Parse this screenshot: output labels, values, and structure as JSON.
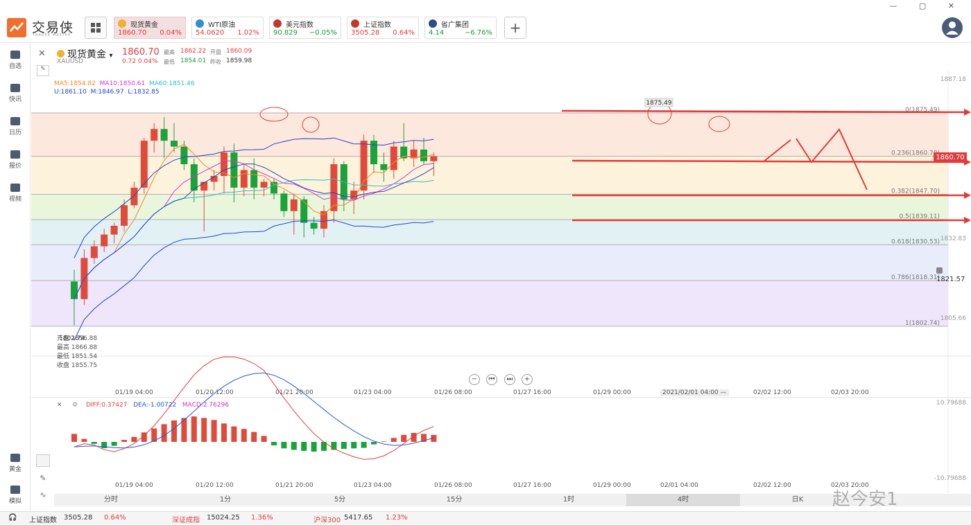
{
  "app": {
    "name": "交易侠",
    "sub": "TRADER MASTER"
  },
  "window_controls": "— ▢ ✕",
  "tickers": [
    {
      "name": "现货黄金",
      "price": "1860.70",
      "pct": "0.04%",
      "color": "#e23b3b",
      "icon_color": "#f0b030",
      "active": true
    },
    {
      "name": "WTI原油",
      "price": "54.0620",
      "pct": "1.02%",
      "color": "#e23b3b",
      "icon_color": "#2d8fd5"
    },
    {
      "name": "美元指数",
      "price": "90.829",
      "pct": "−0.05%",
      "color": "#1a9a3a",
      "icon_color": "#c0392b"
    },
    {
      "name": "上证指数",
      "price": "3505.28",
      "pct": "0.64%",
      "color": "#e23b3b",
      "icon_color": "#c0392b"
    },
    {
      "name": "省广集团",
      "price": "4.14",
      "pct": "−6.76%",
      "color": "#1a9a3a",
      "icon_color": "#2a4d8c"
    }
  ],
  "add_label": "+",
  "nav": [
    {
      "label": "自选",
      "icon": "star-icon"
    },
    {
      "label": "快讯",
      "icon": "news-icon"
    },
    {
      "label": "日历",
      "icon": "calendar-icon"
    },
    {
      "label": "报价",
      "icon": "quote-icon"
    },
    {
      "label": "视频",
      "icon": "video-icon"
    }
  ],
  "nav_bottom": [
    {
      "label": "黄金",
      "icon": "gold-icon"
    },
    {
      "label": "模拟",
      "icon": "simulate-icon"
    }
  ],
  "symbol": {
    "name": "现货黄金",
    "dropdown": "▾",
    "code": "XAUUSD",
    "price": "1860.70",
    "change": "0.72  0.04%",
    "quote_labels": [
      "最高",
      "开盘",
      "最低",
      "昨收"
    ],
    "high": "1862.22",
    "open": "1860.09",
    "low": "1854.01",
    "prev_close": "1859.98"
  },
  "indicators": {
    "ma5": "MA5:1854.82",
    "ma10": "MA10:1850.61",
    "ma60": "MA60:1851.46",
    "boll_u": "U:1861.10",
    "boll_m": "M:1846.97",
    "boll_l": "L:1832.85"
  },
  "macd_legend": {
    "diff": "DIFF:0.37427",
    "dea": "DEA:-1.00722",
    "macd": "MACD:2.76296"
  },
  "fib_levels": [
    {
      "label": "0(1875.49)",
      "price": 1875.49
    },
    {
      "label": "0.236(1860.70)",
      "price": 1860.7
    },
    {
      "label": "0.382(1847.70)",
      "price": 1847.7
    },
    {
      "label": "0.5(1839.11)",
      "price": 1839.11
    },
    {
      "label": "0.618(1830.53)",
      "price": 1830.53
    },
    {
      "label": "0.786(1818.31)",
      "price": 1818.31
    },
    {
      "label": "1(1802.74)",
      "price": 1802.74
    }
  ],
  "price_axis": {
    "top": "1887.18",
    "mid": "1832.83",
    "bottom": "1805.66"
  },
  "current_price_tag": "1860.70",
  "alert_price": "1821.57",
  "high_marker": "1875.49",
  "low_marker": "1802.74",
  "ohlc_box": [
    "开盘 1856.88",
    "最高 1866.88",
    "最低 1851.54",
    "收盘 1855.75"
  ],
  "time_labels": [
    "01/19 04:00",
    "01/20 12:00",
    "01/21 20:00",
    "01/23 04:00",
    "01/26 08:00",
    "01/27 16:00",
    "01/29 00:00",
    "2021/02/01 04:00 —",
    "02/02 12:00",
    "02/03 20:00"
  ],
  "macd_time_labels": [
    "01/19 04:00",
    "01/20 12:00",
    "01/21 20:00",
    "01/23 04:00",
    "01/26 08:00",
    "01/27 16:00",
    "01/29 00:00",
    "02/01 04:00",
    "02/02 12:00",
    "02/03 20:00"
  ],
  "macd_axis": {
    "top": "10.79688",
    "bottom": "-10.79688"
  },
  "zoom_controls": [
    "−",
    "⏮",
    "⏭",
    "+"
  ],
  "periods": [
    "分时",
    "1分",
    "5分",
    "15分",
    "1时",
    "4时",
    "日K"
  ],
  "active_period": "4时",
  "status": {
    "sh_name": "上证指数",
    "sh_val": "3505.28",
    "sh_pct": "0.64%",
    "sz_name": "深证成指",
    "sz_val": "15024.25",
    "sz_pct": "1.36%",
    "hs_name": "沪深300",
    "hs_val": "5417.65",
    "hs_pct": "1.23%"
  },
  "watermark": "赵今安1",
  "chart_data": {
    "type": "candlestick",
    "x": [
      "01/19 04:00",
      "01/20 12:00",
      "01/21 20:00",
      "01/23 04:00",
      "01/26 08:00",
      "01/27 16:00",
      "01/29 00:00",
      "02/01 04:00",
      "02/02 12:00"
    ],
    "ohlc": [
      [
        1818.0,
        1822.0,
        1803.0,
        1812.0
      ],
      [
        1812.0,
        1829.0,
        1810.0,
        1826.0
      ],
      [
        1826.0,
        1832.0,
        1824.0,
        1830.0
      ],
      [
        1830.0,
        1836.0,
        1828.0,
        1834.0
      ],
      [
        1834.0,
        1838.0,
        1831.0,
        1837.0
      ],
      [
        1837.0,
        1846.0,
        1835.0,
        1844.0
      ],
      [
        1844.0,
        1852.0,
        1843.0,
        1850.0
      ],
      [
        1850.0,
        1867.0,
        1848.0,
        1866.0
      ],
      [
        1866.0,
        1872.0,
        1862.0,
        1870.0
      ],
      [
        1870.0,
        1874.0,
        1860.0,
        1866.0
      ],
      [
        1866.0,
        1872.0,
        1862.0,
        1864.0
      ],
      [
        1864.0,
        1866.0,
        1856.0,
        1858.0
      ],
      [
        1858.0,
        1860.0,
        1845.0,
        1849.0
      ],
      [
        1849.0,
        1852.0,
        1835.0,
        1852.0
      ],
      [
        1852.0,
        1856.0,
        1849.0,
        1854.0
      ],
      [
        1854.0,
        1864.0,
        1848.0,
        1862.0
      ],
      [
        1862.0,
        1865.0,
        1845.0,
        1850.0
      ],
      [
        1850.0,
        1858.0,
        1847.0,
        1856.0
      ],
      [
        1856.0,
        1860.0,
        1846.0,
        1850.0
      ],
      [
        1850.0,
        1853.0,
        1847.0,
        1852.0
      ],
      [
        1852.0,
        1853.0,
        1846.0,
        1848.0
      ],
      [
        1848.0,
        1849.0,
        1840.0,
        1842.0
      ],
      [
        1842.0,
        1848.0,
        1834.0,
        1846.0
      ],
      [
        1846.0,
        1847.0,
        1833.0,
        1838.0
      ],
      [
        1838.0,
        1840.0,
        1834.0,
        1836.0
      ],
      [
        1836.0,
        1844.0,
        1833.0,
        1842.0
      ],
      [
        1842.0,
        1860.0,
        1838.0,
        1858.0
      ],
      [
        1858.0,
        1859.0,
        1842.0,
        1846.0
      ],
      [
        1846.0,
        1852.0,
        1841.0,
        1849.0
      ],
      [
        1849.0,
        1868.0,
        1846.0,
        1866.0
      ],
      [
        1866.0,
        1868.0,
        1855.0,
        1858.0
      ],
      [
        1858.0,
        1862.0,
        1852.0,
        1856.0
      ],
      [
        1856.0,
        1866.0,
        1853.0,
        1864.0
      ],
      [
        1864.0,
        1872.0,
        1859.0,
        1860.0
      ],
      [
        1860.0,
        1866.0,
        1857.0,
        1863.0
      ],
      [
        1863.0,
        1867.0,
        1858.0,
        1859.0
      ],
      [
        1859.0,
        1862.0,
        1854.0,
        1860.7
      ]
    ],
    "macd_hist": [
      3.2,
      1.2,
      -0.8,
      -2.5,
      -1.6,
      0.8,
      2.0,
      3.8,
      5.4,
      7.1,
      8.6,
      9.6,
      10.2,
      9.6,
      8.8,
      7.4,
      6.2,
      5.2,
      4.0,
      2.4,
      -1.4,
      -2.6,
      -3.2,
      -3.6,
      -3.9,
      -3.6,
      -3.2,
      -2.8,
      -2.6,
      -2.4,
      -1.0,
      0.2,
      1.6,
      2.8,
      3.6,
      3.2,
      2.8
    ]
  }
}
